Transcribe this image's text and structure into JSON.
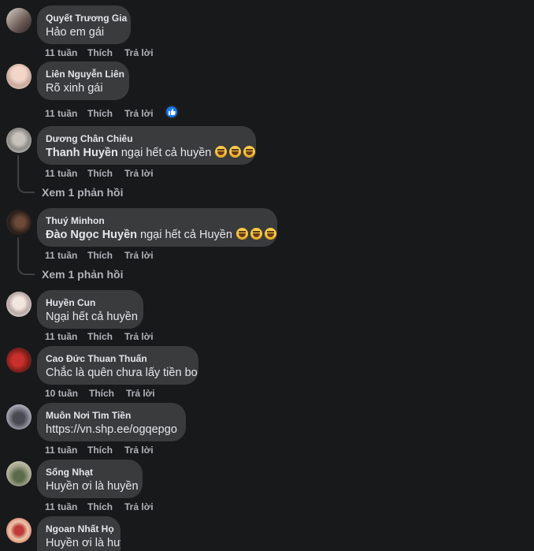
{
  "comments": [
    {
      "author": "Quyết Trương Gia",
      "text": "Hảo em gái",
      "time": "11 tuần",
      "like": "Thích",
      "reply": "Trả lời"
    },
    {
      "author": "Liên Nguyễn Liên",
      "text": "Rõ xinh gái",
      "time": "11 tuần",
      "like": "Thích",
      "reply": "Trả lời",
      "reaction": "like-reaction"
    },
    {
      "author": "Dương Chân Chiêu",
      "tag": "Thanh Huyền",
      "text": " ngại hết cả huyền",
      "emoji_count": 3,
      "time": "11 tuần",
      "like": "Thích",
      "reply": "Trả lời",
      "view_replies": "Xem 1 phản hồi"
    },
    {
      "author": "Thuý Minhon",
      "tag": "Đào Ngọc Huyền",
      "text": " ngại hết cả Huyền",
      "emoji_count": 3,
      "time": "11 tuần",
      "like": "Thích",
      "reply": "Trả lời",
      "view_replies": "Xem 1 phản hồi"
    },
    {
      "author": "Huyền Cun",
      "text": "Ngại hết cả huyền",
      "time": "11 tuần",
      "like": "Thích",
      "reply": "Trả lời"
    },
    {
      "author": "Cao Đức Thuan Thuấn",
      "text": "Chắc là quên chưa lấy tiền bo",
      "time": "10 tuần",
      "like": "Thích",
      "reply": "Trả lời"
    },
    {
      "author": "Muôn Nơi Tìm Tiền",
      "text": "https://vn.shp.ee/ogqepgo",
      "time": "11 tuần",
      "like": "Thích",
      "reply": "Trả lời"
    },
    {
      "author": "Sống Nhạt",
      "text": "Huyền ơi là huyền",
      "time": "11 tuần",
      "like": "Thích",
      "reply": "Trả lời"
    },
    {
      "author": "Ngoan Nhất Họ",
      "text": "Huyền ơi là huyền"
    }
  ],
  "emoji_icon": "rolling-laughing-emoji",
  "colors": {
    "background": "#18191a",
    "bubble": "#3a3b3c",
    "text": "#e4e6eb",
    "secondary": "#b0b3b8",
    "accent": "#1877f2"
  }
}
